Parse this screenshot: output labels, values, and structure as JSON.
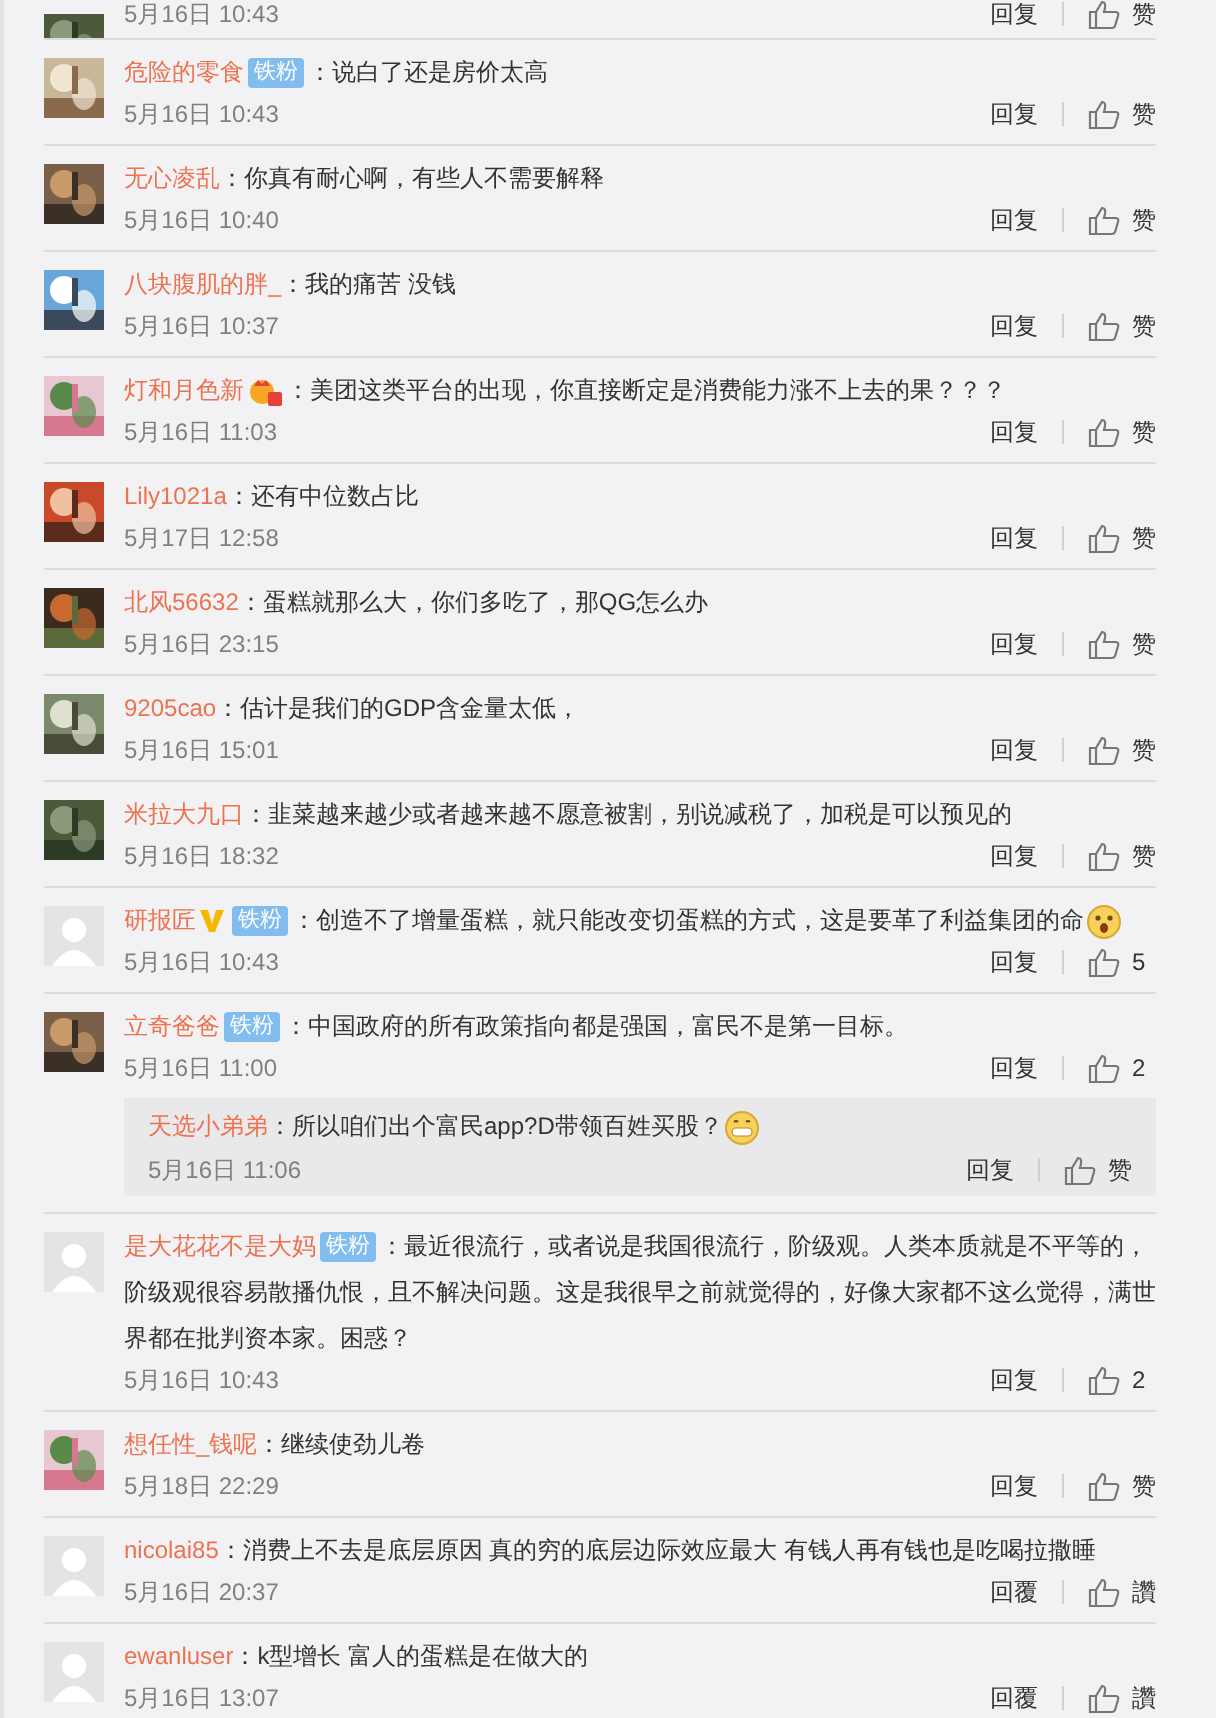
{
  "comments": [
    {
      "partial": true,
      "time": "5月16日 10:43",
      "reply_label": "回复",
      "like_label": "赞"
    },
    {
      "user": "危险的零食",
      "badges": [
        "铁粉"
      ],
      "text": "：说白了还是房价太高",
      "time": "5月16日 10:43",
      "reply_label": "回复",
      "like_label": "赞"
    },
    {
      "user": "无心凌乱",
      "text": "：你真有耐心啊，有些人不需要解释",
      "time": "5月16日 10:40",
      "reply_label": "回复",
      "like_label": "赞"
    },
    {
      "user": "八块腹肌的胖_",
      "text": "：我的痛苦  没钱",
      "time": "5月16日 10:37",
      "reply_label": "回复",
      "like_label": "赞"
    },
    {
      "user": "灯和月色新",
      "medal": true,
      "text": "：美团这类平台的出现，你直接断定是消费能力涨不上去的果？？？",
      "time": "5月16日 11:03",
      "reply_label": "回复",
      "like_label": "赞"
    },
    {
      "user": "Lily1021a",
      "text": "：还有中位数占比",
      "time": "5月17日 12:58",
      "reply_label": "回复",
      "like_label": "赞"
    },
    {
      "user": "北风56632",
      "text": "：蛋糕就那么大，你们多吃了，那QG怎么办",
      "time": "5月16日 23:15",
      "reply_label": "回复",
      "like_label": "赞"
    },
    {
      "user": "9205cao",
      "text": "：估计是我们的GDP含金量太低，",
      "time": "5月16日 15:01",
      "reply_label": "回复",
      "like_label": "赞"
    },
    {
      "user": "米拉大九口",
      "text": "：韭菜越来越少或者越来越不愿意被割，别说减税了，加税是可以预见的",
      "time": "5月16日 18:32",
      "reply_label": "回复",
      "like_label": "赞"
    },
    {
      "avatar": {
        "kind": "default"
      },
      "user": "研报匠",
      "verified": true,
      "badges": [
        "铁粉"
      ],
      "text": "：创造不了增量蛋糕，就只能改变切蛋糕的方式，这是要革了利益集团的命",
      "emoji": {
        "kind": "surprised"
      },
      "time": "5月16日 10:43",
      "reply_label": "回复",
      "like_label": "5"
    },
    {
      "user": "立奇爸爸",
      "badges": [
        "铁粉"
      ],
      "text": "：中国政府的所有政策指向都是强国，富民不是第一目标。",
      "time": "5月16日 11:00",
      "reply_label": "回复",
      "like_label": "2",
      "replies": [
        {
          "user": "天选小弟弟",
          "text": "：所以咱们出个富民app?D带领百姓买股？",
          "emoji": {
            "kind": "grin"
          },
          "time": "5月16日 11:06",
          "reply_label": "回复",
          "like_label": "赞"
        }
      ]
    },
    {
      "avatar": {
        "kind": "default"
      },
      "user": "是大花花不是大妈",
      "badges": [
        "铁粉"
      ],
      "text": "：最近很流行，或者说是我国很流行，阶级观。人类本质就是不平等的，阶级观很容易散播仇恨，且不解决问题。这是我很早之前就觉得的，好像大家都不这么觉得，满世界都在批判资本家。困惑？",
      "time": "5月16日 10:43",
      "reply_label": "回复",
      "like_label": "2"
    },
    {
      "user": "想任性_钱呢",
      "text": "：继续使劲儿卷",
      "time": "5月18日 22:29",
      "reply_label": "回复",
      "like_label": "赞"
    },
    {
      "avatar": {
        "kind": "default"
      },
      "user": "nicolai85",
      "text": "：消费上不去是底层原因  真的穷的底层边际效应最大  有钱人再有钱也是吃喝拉撒睡",
      "time": "5月16日 20:37",
      "reply_label": "回覆",
      "like_label": "讚"
    },
    {
      "avatar": {
        "kind": "default"
      },
      "user": "ewanluser",
      "text": "：k型增长 富人的蛋糕是在做大的",
      "time": "5月16日 13:07",
      "reply_label": "回覆",
      "like_label": "讚"
    }
  ]
}
